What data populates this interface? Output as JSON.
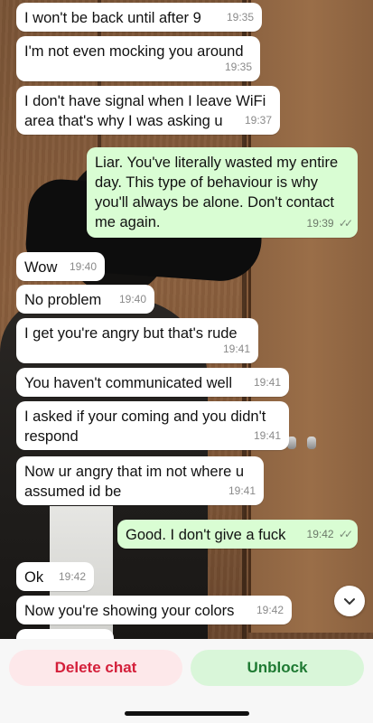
{
  "messages": [
    {
      "dir": "in",
      "text": "I won't be back until after 9",
      "time": "19:35"
    },
    {
      "dir": "in",
      "text": "I'm not even mocking you around",
      "time": "19:35"
    },
    {
      "dir": "in",
      "text": "I don't have signal when I leave WiFi area that's why I was asking u",
      "time": "19:37"
    },
    {
      "dir": "out",
      "text": "Liar. You've literally wasted my entire day. This type of behaviour is why you'll always be alone. Don't contact me again.",
      "time": "19:39",
      "status": "read"
    },
    {
      "dir": "in",
      "text": "Wow",
      "time": "19:40"
    },
    {
      "dir": "in",
      "text": "No problem",
      "time": "19:40"
    },
    {
      "dir": "in",
      "text": "I get you're angry but that's rude",
      "time": "19:41"
    },
    {
      "dir": "in",
      "text": "You haven't communicated well",
      "time": "19:41"
    },
    {
      "dir": "in",
      "text": "I asked if your coming and you didn't respond",
      "time": "19:41"
    },
    {
      "dir": "in",
      "text": "Now ur angry that im not where u assumed id be",
      "time": "19:41"
    },
    {
      "dir": "out",
      "text": "Good. I don't give a fuck",
      "time": "19:42",
      "status": "read"
    },
    {
      "dir": "in",
      "text": "Ok",
      "time": "19:42"
    },
    {
      "dir": "in",
      "text": "Now you're showing your colors",
      "time": "19:42"
    }
  ],
  "read_ticks": "✓✓",
  "scroll_down_icon": "chevron-down-icon",
  "actions": {
    "delete_label": "Delete chat",
    "unblock_label": "Unblock"
  },
  "colors": {
    "incoming_bubble": "#ffffff",
    "outgoing_bubble": "#d9fdd3",
    "delete_text": "#d41f3a",
    "delete_bg": "#fde8ea",
    "unblock_text": "#1f7a33",
    "unblock_bg": "#d9f6d9"
  }
}
